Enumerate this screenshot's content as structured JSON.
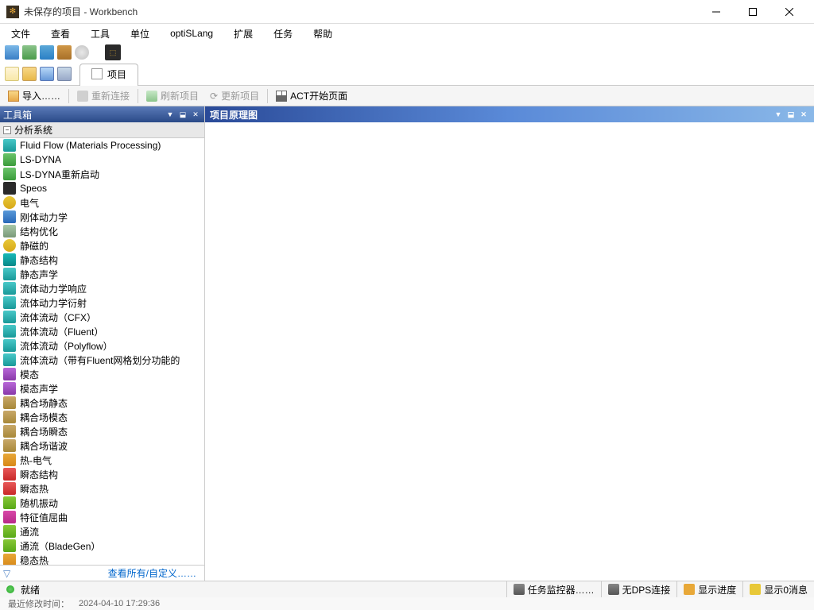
{
  "titlebar": {
    "text": "未保存的项目 - Workbench"
  },
  "menubar": {
    "file": "文件",
    "view": "查看",
    "tools": "工具",
    "units": "单位",
    "optislang": "optiSLang",
    "extensions": "扩展",
    "jobs": "任务",
    "help": "帮助"
  },
  "tab": {
    "project": "项目"
  },
  "toolbar3": {
    "import": "导入……",
    "reconnect": "重新连接",
    "refresh_project": "刷新项目",
    "update_project": "更新项目",
    "act_start": "ACT开始页面"
  },
  "toolbox": {
    "title": "工具箱",
    "category": "分析系统",
    "items": [
      {
        "label": "Fluid Flow (Materials Processing)",
        "ic": "ic-teal"
      },
      {
        "label": "LS-DYNA",
        "ic": "ic-green"
      },
      {
        "label": "LS-DYNA重新启动",
        "ic": "ic-green"
      },
      {
        "label": "Speos",
        "ic": "ic-dkgr"
      },
      {
        "label": "电气",
        "ic": "ic-yel"
      },
      {
        "label": "刚体动力学",
        "ic": "ic-blue"
      },
      {
        "label": "结构优化",
        "ic": "ic-ltgr"
      },
      {
        "label": "静磁的",
        "ic": "ic-yel"
      },
      {
        "label": "静态结构",
        "ic": "ic-teal2"
      },
      {
        "label": "静态声学",
        "ic": "ic-teal"
      },
      {
        "label": "流体动力学响应",
        "ic": "ic-teal"
      },
      {
        "label": "流体动力学衍射",
        "ic": "ic-teal"
      },
      {
        "label": "流体流动（CFX）",
        "ic": "ic-teal"
      },
      {
        "label": "流体流动（Fluent）",
        "ic": "ic-teal"
      },
      {
        "label": "流体流动（Polyflow）",
        "ic": "ic-teal"
      },
      {
        "label": "流体流动（带有Fluent网格划分功能的",
        "ic": "ic-teal"
      },
      {
        "label": "模态",
        "ic": "ic-prp"
      },
      {
        "label": "模态声学",
        "ic": "ic-prp"
      },
      {
        "label": "耦合场静态",
        "ic": "ic-brn"
      },
      {
        "label": "耦合场模态",
        "ic": "ic-brn"
      },
      {
        "label": "耦合场瞬态",
        "ic": "ic-brn"
      },
      {
        "label": "耦合场谐波",
        "ic": "ic-brn"
      },
      {
        "label": "热-电气",
        "ic": "ic-org"
      },
      {
        "label": "瞬态结构",
        "ic": "ic-red"
      },
      {
        "label": "瞬态热",
        "ic": "ic-red"
      },
      {
        "label": "随机振动",
        "ic": "ic-grn2"
      },
      {
        "label": "特征值屈曲",
        "ic": "ic-mag"
      },
      {
        "label": "通流",
        "ic": "ic-grn2"
      },
      {
        "label": "通流（BladeGen）",
        "ic": "ic-grn2"
      },
      {
        "label": "稳态热",
        "ic": "ic-org"
      }
    ],
    "footer_link": "查看所有/自定义……"
  },
  "schematic": {
    "title": "项目原理图"
  },
  "statusbar": {
    "ready": "就绪",
    "monitor": "任务监控器……",
    "dps": "无DPS连接",
    "progress": "显示进度",
    "messages": "显示0消息"
  },
  "bottom": {
    "label": "最近修改时间：",
    "datetime": "2024-04-10 17:29:36"
  }
}
